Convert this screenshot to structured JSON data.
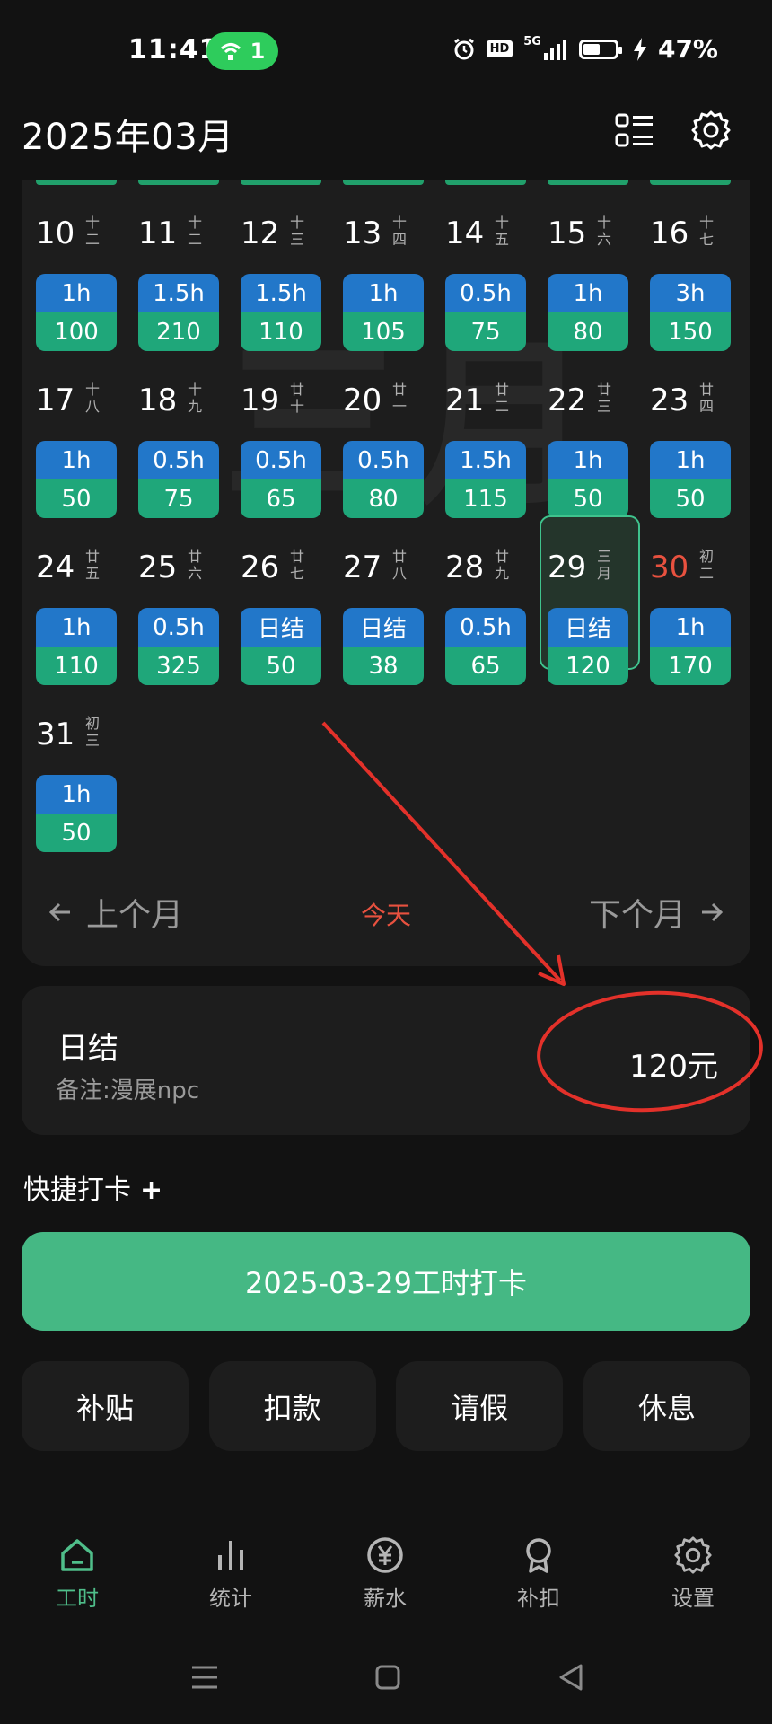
{
  "status_bar": {
    "time": "11:41",
    "hotspot_count": "1",
    "badge_hd": "HD",
    "network": "5G",
    "battery": "47%"
  },
  "header": {
    "title": "2025年03月",
    "icons": [
      "list-icon",
      "gear-icon"
    ]
  },
  "calendar": {
    "days": [
      {
        "day": "10",
        "lunar": "十二",
        "hours": "1h",
        "amount": "100"
      },
      {
        "day": "11",
        "lunar": "十二",
        "hours": "1.5h",
        "amount": "210"
      },
      {
        "day": "12",
        "lunar": "十三",
        "hours": "1.5h",
        "amount": "110"
      },
      {
        "day": "13",
        "lunar": "十四",
        "hours": "1h",
        "amount": "105"
      },
      {
        "day": "14",
        "lunar": "十五",
        "hours": "0.5h",
        "amount": "75"
      },
      {
        "day": "15",
        "lunar": "十六",
        "hours": "1h",
        "amount": "80"
      },
      {
        "day": "16",
        "lunar": "十七",
        "hours": "3h",
        "amount": "150"
      },
      {
        "day": "17",
        "lunar": "十八",
        "hours": "1h",
        "amount": "50"
      },
      {
        "day": "18",
        "lunar": "十九",
        "hours": "0.5h",
        "amount": "75"
      },
      {
        "day": "19",
        "lunar": "廿十",
        "hours": "0.5h",
        "amount": "65"
      },
      {
        "day": "20",
        "lunar": "廿一",
        "hours": "0.5h",
        "amount": "80"
      },
      {
        "day": "21",
        "lunar": "廿二",
        "hours": "1.5h",
        "amount": "115"
      },
      {
        "day": "22",
        "lunar": "廿三",
        "hours": "1h",
        "amount": "50"
      },
      {
        "day": "23",
        "lunar": "廿四",
        "hours": "1h",
        "amount": "50"
      },
      {
        "day": "24",
        "lunar": "廿五",
        "hours": "1h",
        "amount": "110"
      },
      {
        "day": "25",
        "lunar": "廿六",
        "hours": "0.5h",
        "amount": "325"
      },
      {
        "day": "26",
        "lunar": "廿七",
        "hours": "日结",
        "amount": "50"
      },
      {
        "day": "27",
        "lunar": "廿八",
        "hours": "日结",
        "amount": "38"
      },
      {
        "day": "28",
        "lunar": "廿九",
        "hours": "0.5h",
        "amount": "65"
      },
      {
        "day": "29",
        "lunar": "三月",
        "hours": "日结",
        "amount": "120",
        "selected": true
      },
      {
        "day": "30",
        "lunar": "初二",
        "hours": "1h",
        "amount": "170",
        "today": true
      },
      {
        "day": "31",
        "lunar": "初三",
        "hours": "1h",
        "amount": "50"
      }
    ],
    "prev_label": "上个月",
    "today_label": "今天",
    "next_label": "下个月",
    "colors": {
      "hours_bg": "#2277c9",
      "amount_bg": "#1fa77a",
      "today_text": "#e8513f"
    }
  },
  "entry": {
    "title": "日结",
    "note": "备注:漫展npc",
    "amount": "120元"
  },
  "quick": {
    "label": "快捷打卡",
    "plus": "+"
  },
  "clock_button": {
    "label": "2025-03-29工时打卡",
    "color": "#45b884"
  },
  "actions": [
    "补贴",
    "扣款",
    "请假",
    "休息"
  ],
  "tabbar": [
    {
      "label": "工时",
      "icon": "home-icon",
      "active": true
    },
    {
      "label": "统计",
      "icon": "stats-icon"
    },
    {
      "label": "薪水",
      "icon": "yen-icon"
    },
    {
      "label": "补扣",
      "icon": "medal-icon"
    },
    {
      "label": "设置",
      "icon": "gear-icon"
    }
  ]
}
